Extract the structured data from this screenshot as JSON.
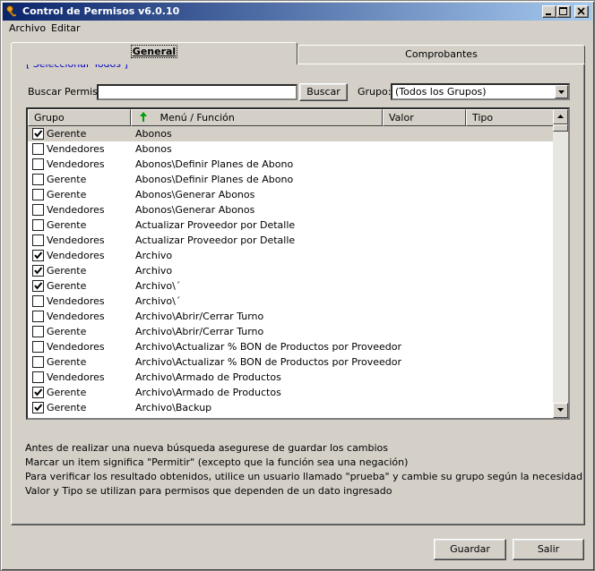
{
  "window": {
    "title": "Control de Permisos v6.0.10"
  },
  "menu": [
    {
      "label": "Archivo"
    },
    {
      "label": "Editar"
    }
  ],
  "tabs": [
    {
      "label": "General"
    },
    {
      "label": "Comprobantes"
    }
  ],
  "select_all_link": "[ Seleccionar Todos ]",
  "search": {
    "label": "Buscar Permiso:",
    "value": "",
    "button": "Buscar"
  },
  "group_filter": {
    "label": "Grupo:",
    "selected": "(Todos los Grupos)"
  },
  "grid": {
    "columns": [
      "Grupo",
      "Menú / Función",
      "Valor",
      "Tipo"
    ],
    "rows": [
      {
        "checked": true,
        "grupo": "Gerente",
        "funcion": "Abonos"
      },
      {
        "checked": false,
        "grupo": "Vendedores",
        "funcion": "Abonos"
      },
      {
        "checked": false,
        "grupo": "Vendedores",
        "funcion": "Abonos\\Definir Planes de Abono"
      },
      {
        "checked": false,
        "grupo": "Gerente",
        "funcion": "Abonos\\Definir Planes de Abono"
      },
      {
        "checked": false,
        "grupo": "Gerente",
        "funcion": "Abonos\\Generar Abonos"
      },
      {
        "checked": false,
        "grupo": "Vendedores",
        "funcion": "Abonos\\Generar Abonos"
      },
      {
        "checked": false,
        "grupo": "Gerente",
        "funcion": "Actualizar Proveedor por Detalle"
      },
      {
        "checked": false,
        "grupo": "Vendedores",
        "funcion": "Actualizar Proveedor por Detalle"
      },
      {
        "checked": true,
        "grupo": "Vendedores",
        "funcion": "Archivo"
      },
      {
        "checked": true,
        "grupo": "Gerente",
        "funcion": "Archivo"
      },
      {
        "checked": true,
        "grupo": "Gerente",
        "funcion": "Archivo\\´"
      },
      {
        "checked": false,
        "grupo": "Vendedores",
        "funcion": "Archivo\\´"
      },
      {
        "checked": false,
        "grupo": "Vendedores",
        "funcion": "Archivo\\Abrir/Cerrar Turno"
      },
      {
        "checked": false,
        "grupo": "Gerente",
        "funcion": "Archivo\\Abrir/Cerrar Turno"
      },
      {
        "checked": false,
        "grupo": "Vendedores",
        "funcion": "Archivo\\Actualizar % BON de Productos por Proveedor"
      },
      {
        "checked": false,
        "grupo": "Gerente",
        "funcion": "Archivo\\Actualizar % BON de Productos por Proveedor"
      },
      {
        "checked": false,
        "grupo": "Vendedores",
        "funcion": "Archivo\\Armado de Productos"
      },
      {
        "checked": true,
        "grupo": "Gerente",
        "funcion": "Archivo\\Armado de Productos"
      },
      {
        "checked": true,
        "grupo": "Gerente",
        "funcion": "Archivo\\Backup"
      }
    ]
  },
  "notes": [
    "Antes de realizar una nueva búsqueda asegurese de guardar los cambios",
    "Marcar un item significa \"Permitir\" (excepto que la función sea una negación)",
    "Para verificar los resultado obtenidos, utilice un usuario llamado \"prueba\" y cambie su grupo según la necesidad",
    "Valor y Tipo se utilizan para permisos que dependen de un dato ingresado"
  ],
  "buttons": {
    "save": "Guardar",
    "exit": "Salir"
  },
  "icons": {
    "app": "key-icon",
    "sort": "sort-up-arrow-icon"
  },
  "colors": {
    "title_start": "#0a246a",
    "title_end": "#a6caf0",
    "link": "#0000c0",
    "sort_arrow": "#00a000"
  }
}
